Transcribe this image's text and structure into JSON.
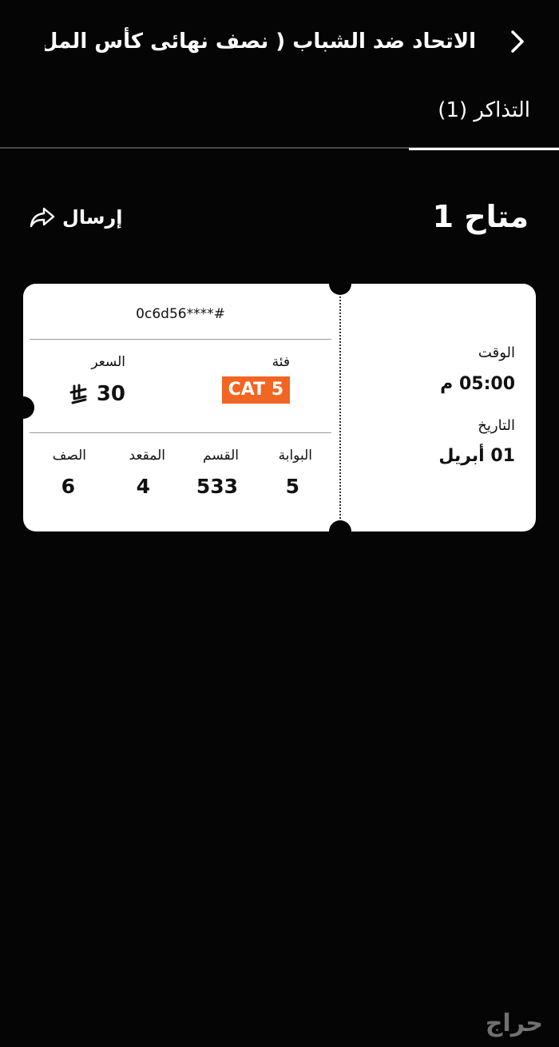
{
  "header": {
    "title": "الاتحاد ضد الشباب ( نصف نهائى كأس المل..."
  },
  "tabs": [
    {
      "label": "التذاكر (1)",
      "active": true
    }
  ],
  "section": {
    "title": "متاح 1",
    "send_label": "إرسال"
  },
  "ticket": {
    "id": "0c6d56****#",
    "category_label": "فئة",
    "category_value": "CAT 5",
    "category_color": "#f26522",
    "price_label": "السعر",
    "price_value": "30",
    "gate_label": "البوابة",
    "gate_value": "5",
    "section_label": "القسم",
    "section_value": "533",
    "seat_label": "المقعد",
    "seat_value": "4",
    "row_label": "الصف",
    "row_value": "6",
    "time_label": "الوقت",
    "time_value": "05:00 م",
    "date_label": "التاريخ",
    "date_value": "01 أبريل"
  },
  "icons": {
    "back": "chevron-right-icon",
    "send": "share-arrow-icon",
    "currency": "riyal-icon"
  },
  "watermark": "حراج",
  "colors": {
    "background": "#050506",
    "accent": "#f26522",
    "ticket": "#ffffff"
  }
}
